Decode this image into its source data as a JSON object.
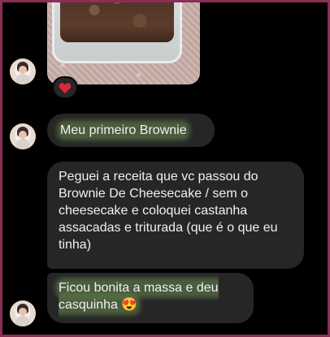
{
  "messages": [
    {
      "type": "photo",
      "reaction": "heart"
    },
    {
      "type": "text",
      "text": "Meu primeiro Brownie",
      "highlighted": true
    },
    {
      "type": "text",
      "text": "Peguei a receita que vc passou do Brownie De Cheesecake / sem o cheesecake e coloquei castanha assacadas e triturada (que é o que eu tinha)"
    },
    {
      "type": "text",
      "text": "Ficou bonita a massa e deu casquinha 😍",
      "highlighted": true
    }
  ],
  "colors": {
    "background": "#000000",
    "bubble": "#262626",
    "highlight": "#78a05a",
    "frame": "#8a2f55",
    "heart": "#e0263c"
  }
}
